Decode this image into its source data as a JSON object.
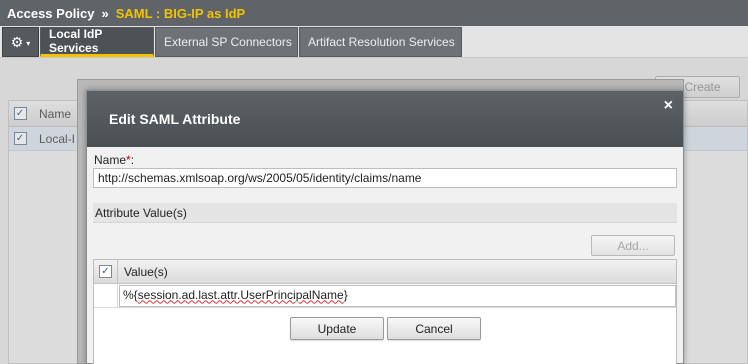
{
  "breadcrumb": {
    "root": "Access Policy",
    "separator": "»",
    "current": "SAML : BIG-IP as IdP"
  },
  "tabs": [
    {
      "label": "Local IdP Services",
      "active": true
    },
    {
      "label": "External SP Connectors",
      "active": false
    },
    {
      "label": "Artifact Resolution Services",
      "active": false
    }
  ],
  "gear_menu": {
    "icon": "gear-icon",
    "caret": "▾"
  },
  "background": {
    "create_label": "Create",
    "table": {
      "header_name": "Name",
      "row_text": "Local-I"
    }
  },
  "modal": {
    "title": "Edit SAML Attribute",
    "close_glyph": "×",
    "name_label": "Name",
    "required_mark": "*",
    "name_label_suffix": ":",
    "name_value": "http://schemas.xmlsoap.org/ws/2005/05/identity/claims/name",
    "attr_section_label": "Attribute Value(s)",
    "add_label": "Add...",
    "values_header": "Value(s)",
    "value_prefix": "%{",
    "value_underlined": "session.ad.last.attr.UserPrincipalName",
    "value_suffix": "}",
    "update_label": "Update",
    "cancel_label": "Cancel"
  },
  "colors": {
    "accent": "#f4c300",
    "topbar": "#5f6468"
  }
}
